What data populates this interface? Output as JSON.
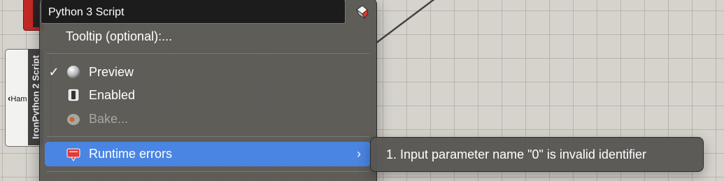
{
  "component": {
    "name_field": "Python 3 Script",
    "clear_icon": "eraser-icon"
  },
  "canvas_component": {
    "title": "IronPython 2 Script",
    "input_label": "Ham",
    "input_arrow": "‹"
  },
  "menu": {
    "tooltip_label": "Tooltip (optional):...",
    "items": [
      {
        "label": "Preview",
        "checked": true,
        "check_glyph": "✓",
        "icon": "sphere-icon",
        "disabled": false
      },
      {
        "label": "Enabled",
        "checked": false,
        "icon": "toggle-icon",
        "disabled": false
      },
      {
        "label": "Bake...",
        "checked": false,
        "icon": "bake-egg-icon",
        "disabled": true
      }
    ],
    "runtime_errors": {
      "label": "Runtime errors",
      "icon": "error-flag-icon",
      "submenu_arrow": "›"
    }
  },
  "submenu": {
    "items": [
      "1. Input parameter name \"0\" is invalid identifier"
    ]
  },
  "colors": {
    "canvas_bg": "#d6d3cd",
    "menu_bg": "#585753",
    "highlight": "#4a85e3",
    "component_red": "#c52a26",
    "error_icon_red": "#e03a3a"
  }
}
